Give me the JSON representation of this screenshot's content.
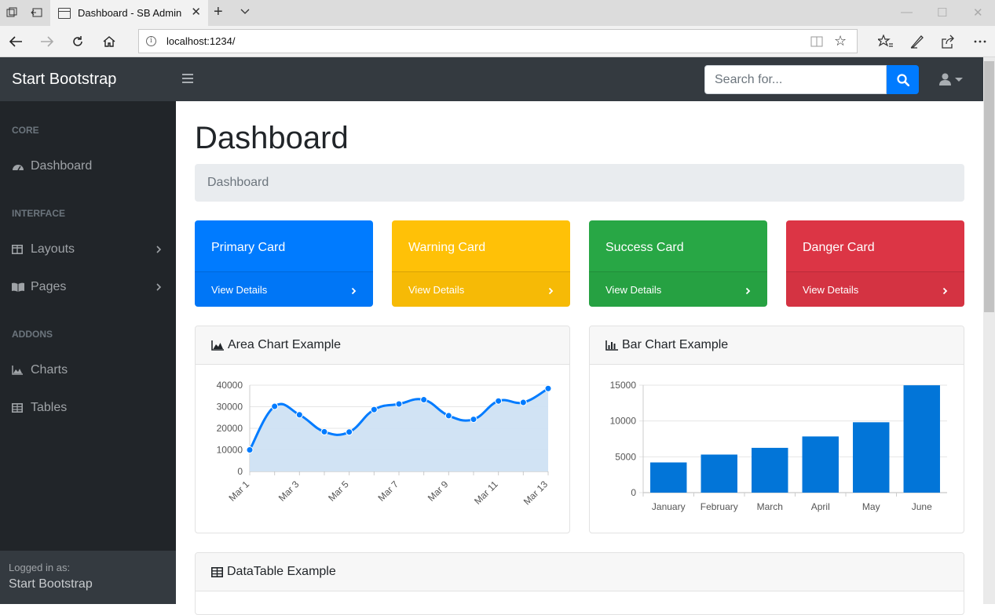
{
  "browser": {
    "tab_title": "Dashboard - SB Admin",
    "url": "localhost:1234/"
  },
  "navbar": {
    "brand": "Start Bootstrap",
    "search_placeholder": "Search for..."
  },
  "sidebar": {
    "sections": [
      {
        "heading": "Core",
        "items": [
          {
            "label": "Dashboard",
            "icon": "tachometer-icon",
            "chevron": false
          }
        ]
      },
      {
        "heading": "Interface",
        "items": [
          {
            "label": "Layouts",
            "icon": "columns-icon",
            "chevron": true
          },
          {
            "label": "Pages",
            "icon": "book-open-icon",
            "chevron": true
          }
        ]
      },
      {
        "heading": "Addons",
        "items": [
          {
            "label": "Charts",
            "icon": "chart-area-icon",
            "chevron": false
          },
          {
            "label": "Tables",
            "icon": "table-icon",
            "chevron": false
          }
        ]
      }
    ],
    "footer": {
      "label": "Logged in as:",
      "name": "Start Bootstrap"
    }
  },
  "main": {
    "title": "Dashboard",
    "breadcrumb": "Dashboard",
    "cards": [
      {
        "title": "Primary Card",
        "footer": "View Details",
        "color": "#007bff"
      },
      {
        "title": "Warning Card",
        "footer": "View Details",
        "color": "#ffc107"
      },
      {
        "title": "Success Card",
        "footer": "View Details",
        "color": "#28a745"
      },
      {
        "title": "Danger Card",
        "footer": "View Details",
        "color": "#dc3545"
      }
    ],
    "area_panel_title": "Area Chart Example",
    "bar_panel_title": "Bar Chart Example",
    "table_panel_title": "DataTable Example"
  },
  "chart_data": [
    {
      "type": "area",
      "x": [
        "Mar 1",
        "Mar 2",
        "Mar 3",
        "Mar 4",
        "Mar 5",
        "Mar 6",
        "Mar 7",
        "Mar 8",
        "Mar 9",
        "Mar 10",
        "Mar 11",
        "Mar 12",
        "Mar 13"
      ],
      "xticks": [
        "Mar 1",
        "Mar 3",
        "Mar 5",
        "Mar 7",
        "Mar 9",
        "Mar 11",
        "Mar 13"
      ],
      "values": [
        10000,
        30162,
        26263,
        18394,
        18287,
        28682,
        31274,
        33259,
        25849,
        24159,
        32651,
        31984,
        38451
      ],
      "ylim": [
        0,
        40000
      ],
      "yticks": [
        0,
        10000,
        20000,
        30000,
        40000
      ],
      "line_color": "#007bff",
      "fill_color": "#cfe2f3",
      "grid": true
    },
    {
      "type": "bar",
      "categories": [
        "January",
        "February",
        "March",
        "April",
        "May",
        "June"
      ],
      "values": [
        4215,
        5312,
        6251,
        7841,
        9821,
        14984
      ],
      "ylim": [
        0,
        15000
      ],
      "yticks": [
        0,
        5000,
        10000,
        15000
      ],
      "bar_color": "#0275d8",
      "grid": true
    }
  ]
}
